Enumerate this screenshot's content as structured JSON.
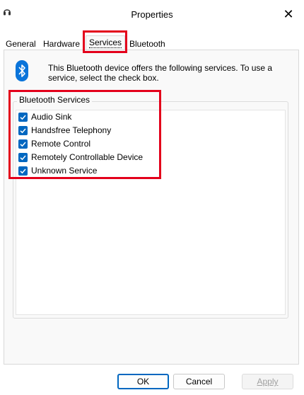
{
  "window": {
    "title": "Properties",
    "close_glyph": "✕"
  },
  "tabs": [
    {
      "label": "General"
    },
    {
      "label": "Hardware"
    },
    {
      "label": "Services"
    },
    {
      "label": "Bluetooth"
    }
  ],
  "active_tab": "Services",
  "services_page": {
    "description": "This Bluetooth device offers the following services. To use a service, select the check box.",
    "group_label": "Bluetooth Services",
    "services": [
      {
        "label": "Audio Sink",
        "checked": true
      },
      {
        "label": "Handsfree Telephony",
        "checked": true
      },
      {
        "label": "Remote Control",
        "checked": true
      },
      {
        "label": "Remotely Controllable Device",
        "checked": true
      },
      {
        "label": "Unknown Service",
        "checked": true
      }
    ]
  },
  "buttons": {
    "ok": "OK",
    "cancel": "Cancel",
    "apply": "Apply"
  },
  "colors": {
    "accent": "#0067c0",
    "highlight": "#e3001b",
    "bluetooth_blue": "#0a74da"
  },
  "icons": {
    "title": "headset-icon",
    "bluetooth": "bluetooth-icon",
    "checkbox": "check-icon"
  }
}
